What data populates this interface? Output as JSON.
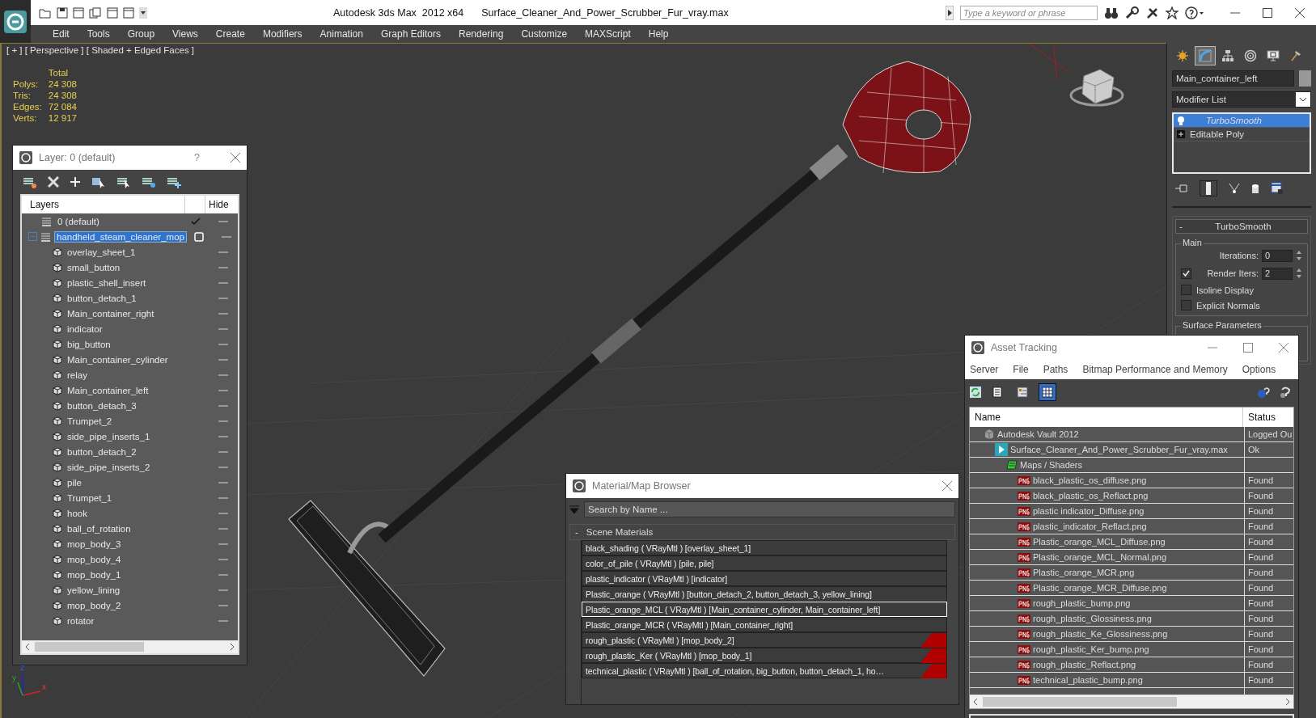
{
  "window": {
    "app_title": "Autodesk 3ds Max  2012 x64",
    "file_title": "Surface_Cleaner_And_Power_Scrubber_Fur_vray.max"
  },
  "search": {
    "placeholder": "Type a keyword or phrase"
  },
  "menu": [
    "Edit",
    "Tools",
    "Group",
    "Views",
    "Create",
    "Modifiers",
    "Animation",
    "Graph Editors",
    "Rendering",
    "Customize",
    "MAXScript",
    "Help"
  ],
  "viewport": {
    "label": "[ + ] [ Perspective ] [ Shaded + Edged Faces ]",
    "stats_header": "Total",
    "stats": [
      {
        "label": "Polys:",
        "value": "24 308"
      },
      {
        "label": "Tris:",
        "value": "24 308"
      },
      {
        "label": "Edges:",
        "value": "72 084"
      },
      {
        "label": "Verts:",
        "value": "12 917"
      }
    ],
    "axes": [
      "z",
      "y",
      "x"
    ]
  },
  "layer_window": {
    "title": "Layer: 0 (default)",
    "help": "?",
    "columns": [
      "Layers",
      "Hide"
    ],
    "layers": [
      {
        "name": "0 (default)",
        "current": true,
        "selected": false
      },
      {
        "name": "handheld_steam_cleaner_mop",
        "current": false,
        "selected": true,
        "expanded": true,
        "children": [
          {
            "name": "overlay_sheet_1",
            "selected": false
          },
          {
            "name": "small_button",
            "selected": false
          },
          {
            "name": "plastic_shell_insert",
            "selected": false
          },
          {
            "name": "button_detach_1",
            "selected": false
          },
          {
            "name": "Main_container_right",
            "selected": false
          },
          {
            "name": "indicator",
            "selected": false
          },
          {
            "name": "big_button",
            "selected": false
          },
          {
            "name": "Main_container_cylinder",
            "selected": false
          },
          {
            "name": "relay",
            "selected": false
          },
          {
            "name": "Main_container_left",
            "selected": false
          },
          {
            "name": "button_detach_3",
            "selected": false
          },
          {
            "name": "Trumpet_2",
            "selected": false
          },
          {
            "name": "side_pipe_inserts_1",
            "selected": false
          },
          {
            "name": "button_detach_2",
            "selected": false
          },
          {
            "name": "side_pipe_inserts_2",
            "selected": false
          },
          {
            "name": "pile",
            "selected": false
          },
          {
            "name": "Trumpet_1",
            "selected": false
          },
          {
            "name": "hook",
            "selected": false
          },
          {
            "name": "ball_of_rotation",
            "selected": false
          },
          {
            "name": "mop_body_3",
            "selected": false
          },
          {
            "name": "mop_body_4",
            "selected": false
          },
          {
            "name": "mop_body_1",
            "selected": false
          },
          {
            "name": "yellow_lining",
            "selected": false
          },
          {
            "name": "mop_body_2",
            "selected": false
          },
          {
            "name": "rotator",
            "selected": false
          }
        ]
      }
    ]
  },
  "material_browser": {
    "title": "Material/Map Browser",
    "search_placeholder": "Search by Name ...",
    "group": {
      "sign": "-",
      "label": "Scene Materials"
    },
    "materials": [
      {
        "text": "black_shading ( VRayMtl ) [overlay_sheet_1]",
        "selected": false,
        "flagged": false
      },
      {
        "text": "color_of_pile ( VRayMtl ) [pile, pile]",
        "selected": false,
        "flagged": false
      },
      {
        "text": "plastic_indicator ( VRayMtl ) [indicator]",
        "selected": false,
        "flagged": false
      },
      {
        "text": "Plastic_orange ( VRayMtl ) [button_detach_2, button_detach_3, yellow_lining]",
        "selected": false,
        "flagged": false
      },
      {
        "text": "Plastic_orange_MCL ( VRayMtl ) [Main_container_cylinder, Main_container_left]",
        "selected": true,
        "flagged": false
      },
      {
        "text": "Plastic_orange_MCR ( VRayMtl ) [Main_container_right]",
        "selected": false,
        "flagged": false
      },
      {
        "text": "rough_plastic ( VRayMtl ) [mop_body_2]",
        "selected": false,
        "flagged": true
      },
      {
        "text": "rough_plastic_Ker ( VRayMtl ) [mop_body_1]",
        "selected": false,
        "flagged": true
      },
      {
        "text": "technical_plastic ( VRayMtl ) [ball_of_rotation, big_button, button_detach_1, ho…",
        "selected": false,
        "flagged": true
      }
    ]
  },
  "asset_tracking": {
    "title": "Asset Tracking",
    "menu": [
      "Server",
      "File",
      "Paths",
      "Bitmap Performance and Memory",
      "Options"
    ],
    "view_buttons": [
      {
        "selected": false
      },
      {
        "selected": false
      },
      {
        "selected": true
      }
    ],
    "columns": [
      "Name",
      "Status"
    ],
    "rows": [
      {
        "kind": "vault",
        "name": "Autodesk Vault 2012",
        "status": "Logged Ou",
        "children": [
          {
            "kind": "scene",
            "name": "Surface_Cleaner_And_Power_Scrubber_Fur_vray.max",
            "status": "Ok",
            "children": [
              {
                "kind": "folder",
                "name": "Maps / Shaders",
                "children": [
                  {
                    "kind": "png",
                    "name": "black_plastic_os_diffuse.png",
                    "status": "Found"
                  },
                  {
                    "kind": "png",
                    "name": "black_plastic_os_Reflact.png",
                    "status": "Found"
                  },
                  {
                    "kind": "png",
                    "name": "plastic indicator_Diffuse.png",
                    "status": "Found"
                  },
                  {
                    "kind": "png",
                    "name": "plastic_indicator_Reflact.png",
                    "status": "Found"
                  },
                  {
                    "kind": "png",
                    "name": "Plastic_orange_MCL_Diffuse.png",
                    "status": "Found"
                  },
                  {
                    "kind": "png",
                    "name": "Plastic_orange_MCL_Normal.png",
                    "status": "Found"
                  },
                  {
                    "kind": "png",
                    "name": "Plastic_orange_MCR.png",
                    "status": "Found"
                  },
                  {
                    "kind": "png",
                    "name": "Plastic_orange_MCR_Diffuse.png",
                    "status": "Found"
                  },
                  {
                    "kind": "png",
                    "name": "rough_plastic_bump.png",
                    "status": "Found"
                  },
                  {
                    "kind": "png",
                    "name": "rough_plastic_Glossiness.png",
                    "status": "Found"
                  },
                  {
                    "kind": "png",
                    "name": "rough_plastic_Ke_Glossiness.png",
                    "status": "Found"
                  },
                  {
                    "kind": "png",
                    "name": "rough_plastic_Ker_bump.png",
                    "status": "Found"
                  },
                  {
                    "kind": "png",
                    "name": "rough_plastic_Reflact.png",
                    "status": "Found"
                  },
                  {
                    "kind": "png",
                    "name": "technical_plastic_bump.png",
                    "status": "Found"
                  }
                ]
              }
            ]
          }
        ]
      }
    ]
  },
  "command_panel": {
    "tabs": [
      {
        "kind": "sun",
        "selected": false
      },
      {
        "kind": "curve",
        "selected": true
      },
      {
        "kind": "hierarchy",
        "selected": false
      },
      {
        "kind": "rings",
        "selected": false
      },
      {
        "kind": "monitor",
        "selected": false
      },
      {
        "kind": "hammer",
        "selected": false
      }
    ],
    "object_name": "Main_container_left",
    "modifier_list": "Modifier List",
    "stack": [
      {
        "name": "TurboSmooth",
        "selected": true
      },
      {
        "name": "Editable Poly",
        "selected": false
      }
    ],
    "rollout": {
      "sign": "-",
      "title": "TurboSmooth",
      "main_group": "Main",
      "iterations": {
        "label": "Iterations:",
        "value": "0"
      },
      "render_iters": {
        "label": "Render Iters:",
        "value": "2",
        "checked": true
      },
      "options": [
        {
          "label": "Isoline Display",
          "checked": false
        },
        {
          "label": "Explicit Normals",
          "checked": false
        }
      ],
      "surface_group": "Surface Parameters"
    }
  }
}
